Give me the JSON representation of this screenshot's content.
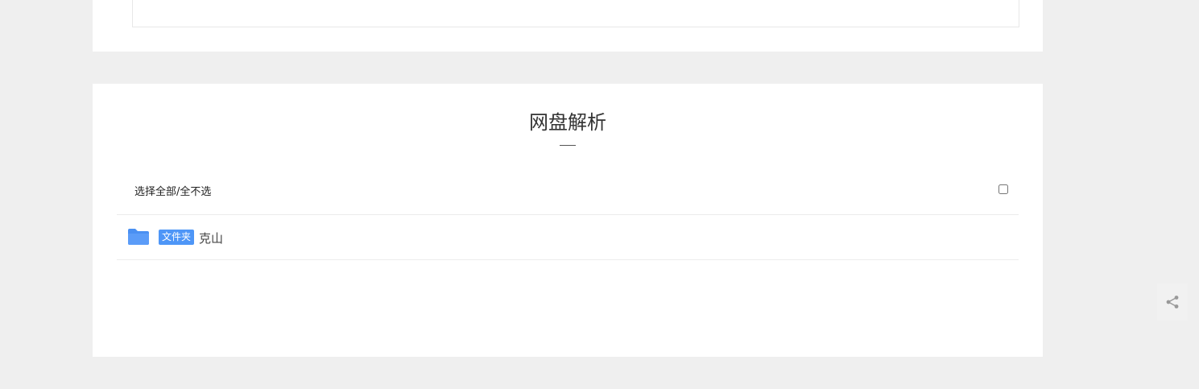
{
  "section": {
    "title": "网盘解析"
  },
  "select_all": {
    "label": "选择全部/全不选",
    "checked": false
  },
  "items": [
    {
      "type_tag": "文件夹",
      "name": "克山",
      "icon": "folder-icon"
    }
  ],
  "colors": {
    "page_background": "#efefef",
    "card_background": "#ffffff",
    "tag_background": "#4e96f7",
    "folder_icon": "#5b9cf8"
  },
  "share": {
    "icon": "share-icon"
  }
}
